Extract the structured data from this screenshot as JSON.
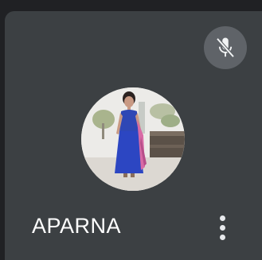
{
  "participant": {
    "name": "APARNA",
    "mic_state_icon": "mic-off-icon",
    "avatar_icon": "participant-photo",
    "more_icon": "more-vert-icon"
  },
  "colors": {
    "page_bg": "#202124",
    "tile_bg": "#3c4043",
    "badge_bg": "#5f6368",
    "text": "#ffffff"
  }
}
